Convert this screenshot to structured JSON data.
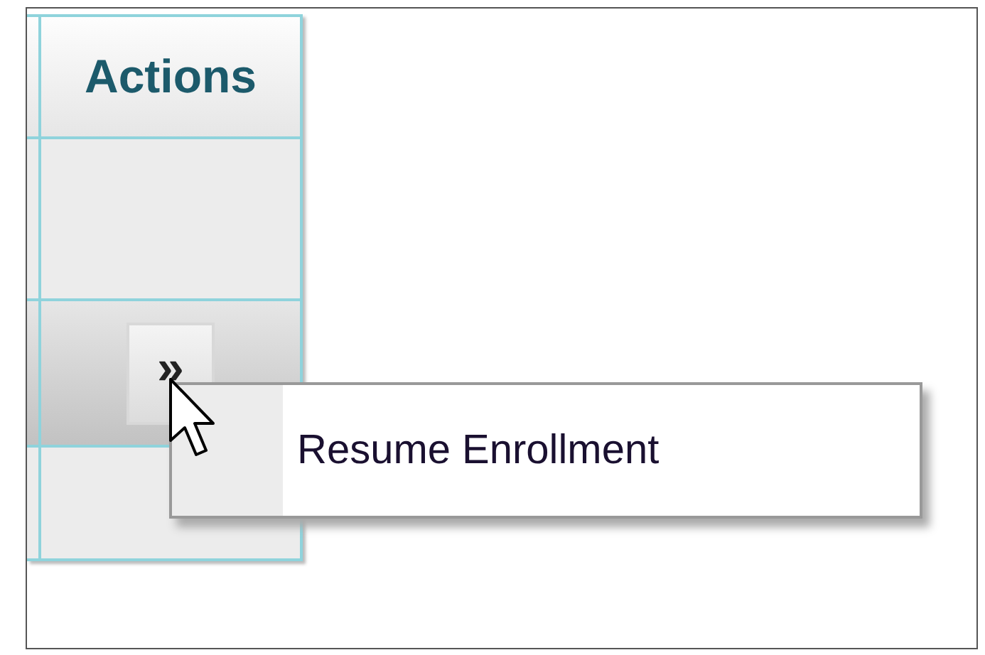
{
  "table": {
    "header": "Actions",
    "rows": [
      {
        "kind": "empty",
        "selected": false
      },
      {
        "kind": "action",
        "selected": true,
        "button": "»"
      },
      {
        "kind": "empty",
        "selected": false
      }
    ]
  },
  "context_menu": {
    "items": [
      {
        "label": "Resume Enrollment"
      }
    ]
  }
}
